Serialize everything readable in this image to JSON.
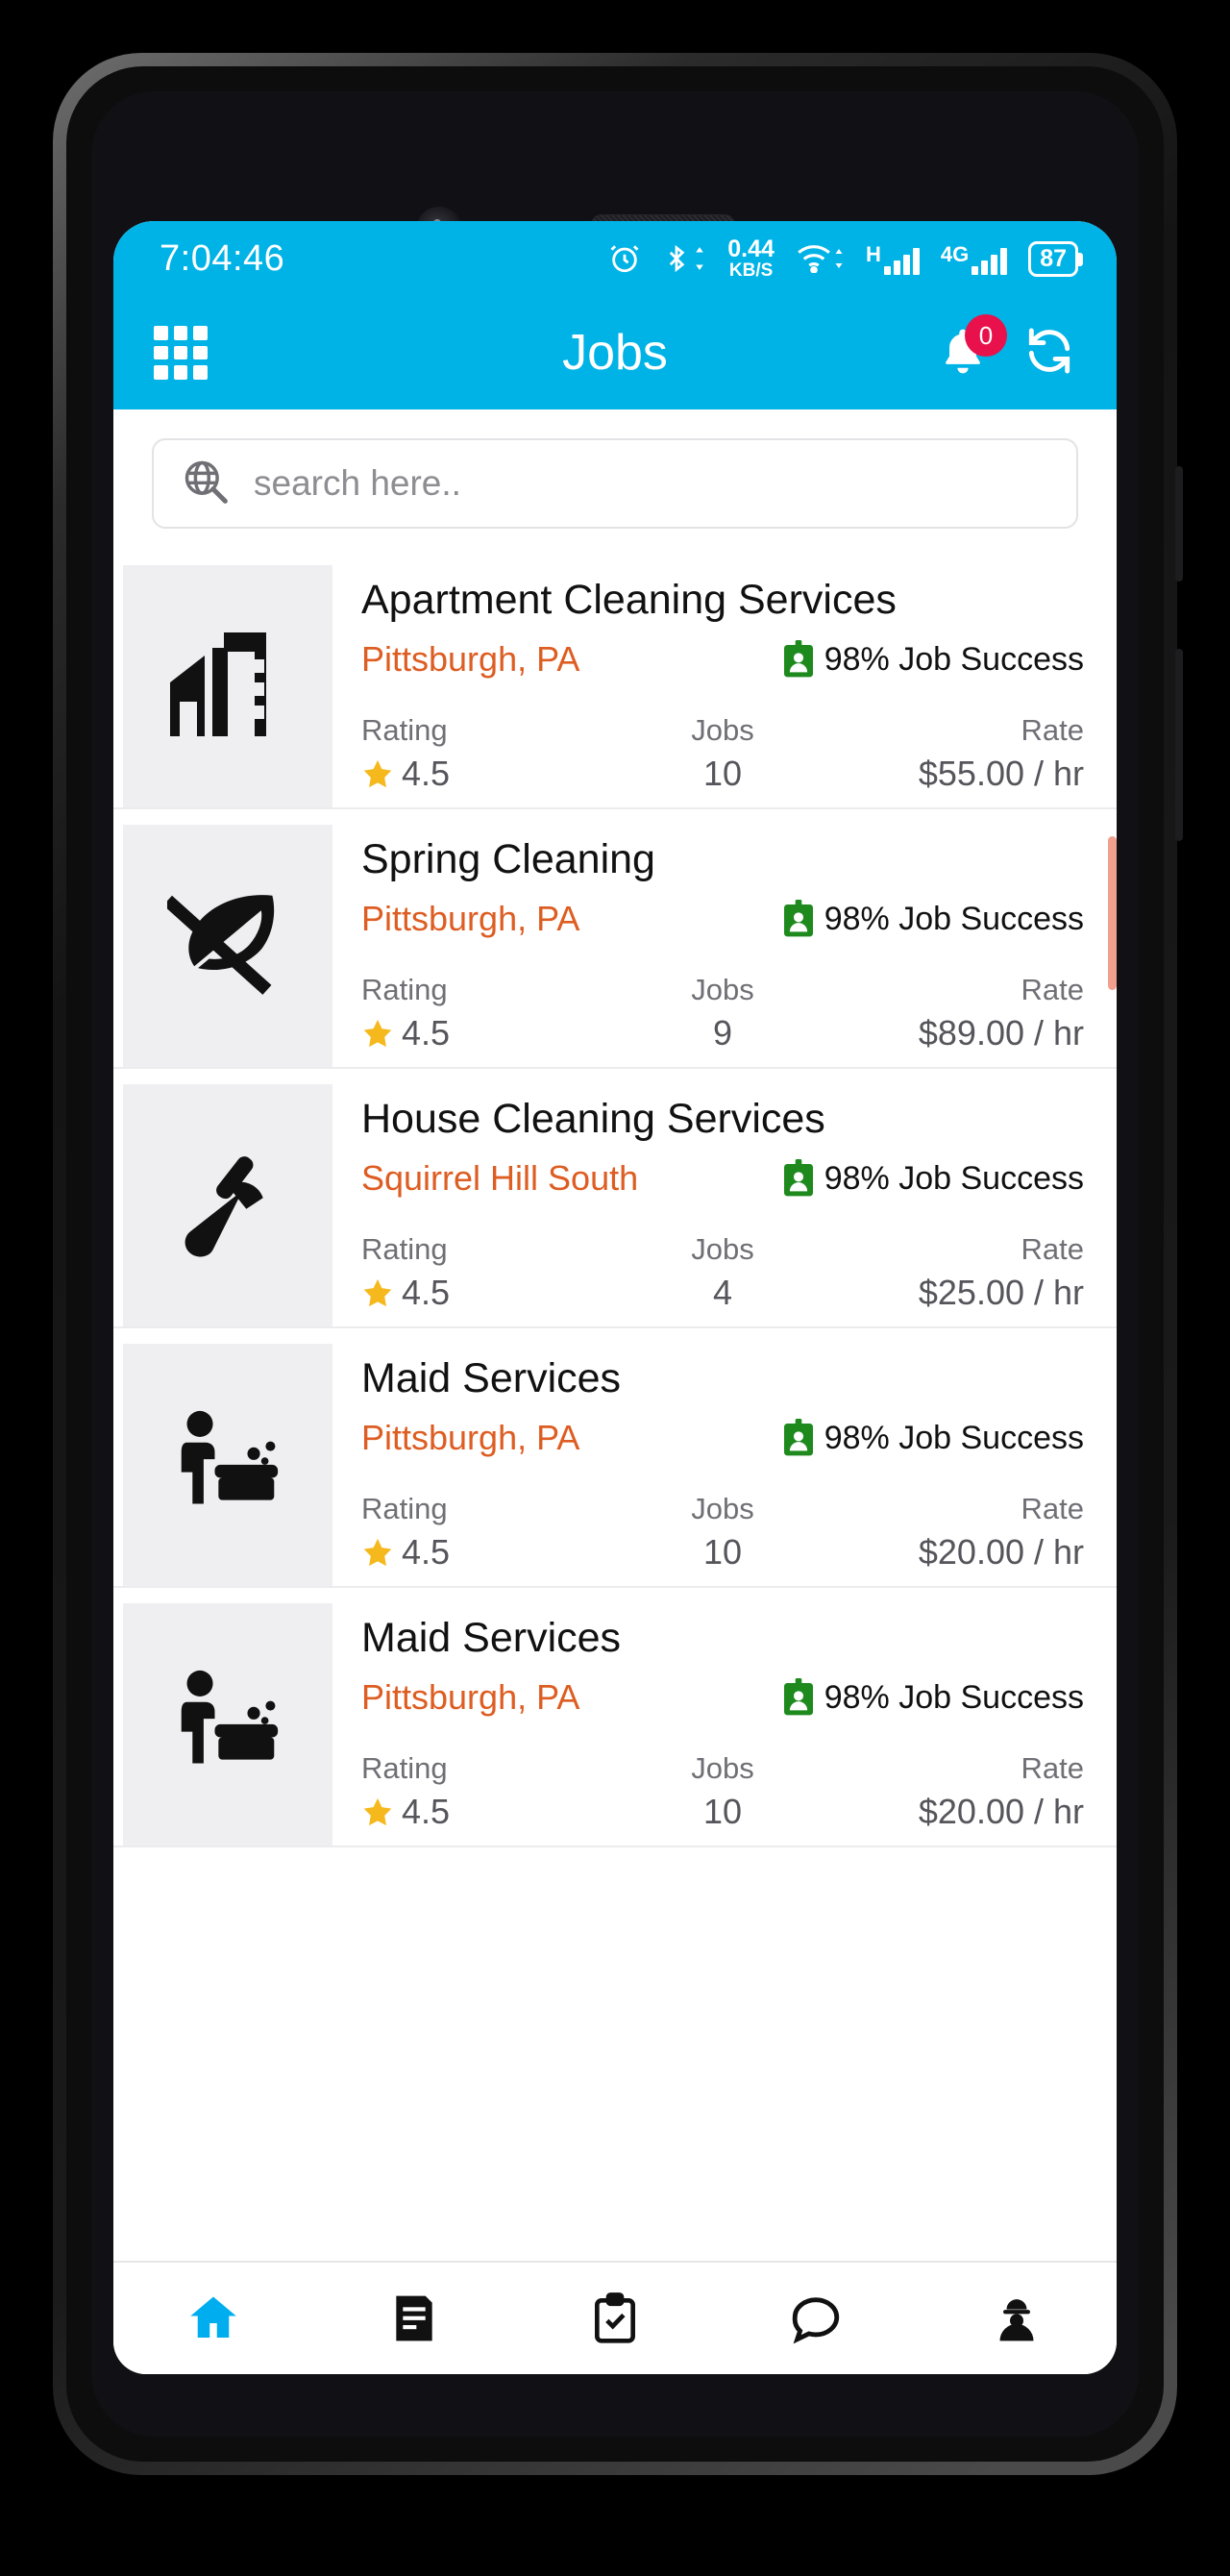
{
  "status_bar": {
    "time": "7:04:46",
    "net_speed_value": "0.44",
    "net_speed_unit": "KB/S",
    "signal_1_label": "H",
    "signal_2_label": "4G",
    "battery_level": "87",
    "icons": [
      "alarm-icon",
      "bluetooth-icon",
      "network-speed",
      "wifi-icon",
      "signal-h-icon",
      "signal-4g-icon",
      "battery-icon"
    ]
  },
  "app_bar": {
    "title": "Jobs",
    "grid_icon": "grid-menu-icon",
    "bell_icon": "notification-bell-icon",
    "badge_count": "0",
    "refresh_icon": "refresh-icon"
  },
  "search": {
    "placeholder": "search here..",
    "icon": "globe-search-icon"
  },
  "colors": {
    "accent": "#00b3e6",
    "location": "#dd5d22",
    "badge": "#e8114b",
    "success": "#1e8a1e",
    "star": "#f5b91d"
  },
  "stat_headers": {
    "rating": "Rating",
    "jobs": "Jobs",
    "rate": "Rate"
  },
  "jobs": [
    {
      "title": "Apartment Cleaning Services",
      "location": "Pittsburgh, PA",
      "success": "98% Job Success",
      "rating": "4.5",
      "jobs_count": "10",
      "rate": "$55.00 / hr",
      "icon": "apartment-building-icon"
    },
    {
      "title": "Spring Cleaning",
      "location": "Pittsburgh, PA",
      "success": "98% Job Success",
      "rating": "4.5",
      "jobs_count": "9",
      "rate": "$89.00 / hr",
      "icon": "leaf-crossed-icon"
    },
    {
      "title": "House Cleaning Services",
      "location": "Squirrel Hill South",
      "success": "98% Job Success",
      "rating": "4.5",
      "jobs_count": "4",
      "rate": "$25.00 / hr",
      "icon": "broom-icon"
    },
    {
      "title": "Maid Services",
      "location": "Pittsburgh, PA",
      "success": "98% Job Success",
      "rating": "4.5",
      "jobs_count": "10",
      "rate": "$20.00 / hr",
      "icon": "maid-cleaning-icon"
    },
    {
      "title": "Maid Services",
      "location": "Pittsburgh, PA",
      "success": "98% Job Success",
      "rating": "4.5",
      "jobs_count": "10",
      "rate": "$20.00 / hr",
      "icon": "maid-cleaning-icon"
    }
  ],
  "bottom_nav": [
    {
      "icon": "home-icon",
      "active": true
    },
    {
      "icon": "notes-icon",
      "active": false
    },
    {
      "icon": "clipboard-check-icon",
      "active": false
    },
    {
      "icon": "chat-bubble-icon",
      "active": false
    },
    {
      "icon": "worker-profile-icon",
      "active": false
    }
  ]
}
